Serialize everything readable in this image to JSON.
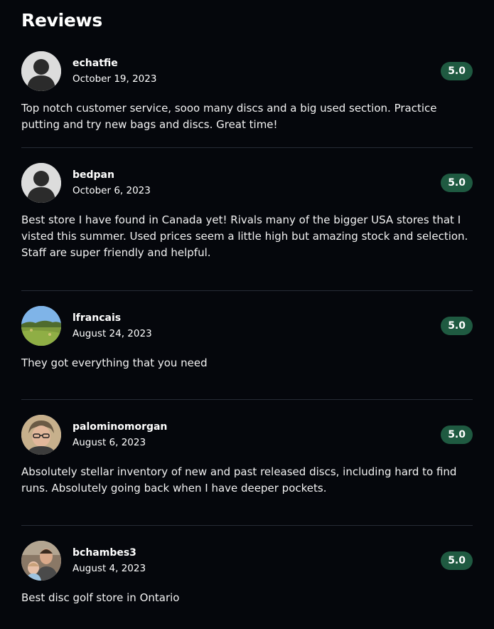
{
  "section": {
    "title": "Reviews"
  },
  "reviews": [
    {
      "username": "echatfie",
      "date": "October 19, 2023",
      "rating": "5.0",
      "text": "Top notch customer service, sooo many discs and a big used section. Practice putting and try new bags and discs. Great time!",
      "avatar": "default-avatar-icon"
    },
    {
      "username": "bedpan",
      "date": "October 6, 2023",
      "rating": "5.0",
      "text": "Best store I have found in Canada yet! Rivals many of the bigger USA stores that I visted this summer. Used prices seem a little high but amazing stock and selection. Staff are super friendly and helpful.",
      "avatar": "default-avatar-icon"
    },
    {
      "username": "lfrancais",
      "date": "August 24, 2023",
      "rating": "5.0",
      "text": "They got everything that you need",
      "avatar": "landscape-photo-avatar"
    },
    {
      "username": "palominomorgan",
      "date": "August 6, 2023",
      "rating": "5.0",
      "text": "Absolutely stellar inventory of new and past released discs, including hard to find runs. Absolutely going back when I have deeper pockets.",
      "avatar": "person-photo-avatar"
    },
    {
      "username": "bchambes3",
      "date": "August 4, 2023",
      "rating": "5.0",
      "text": "Best disc golf store in Ontario",
      "avatar": "family-photo-avatar"
    }
  ],
  "colors": {
    "background": "#05070c",
    "rating_badge": "#1f5a41",
    "divider": "#262c36"
  }
}
